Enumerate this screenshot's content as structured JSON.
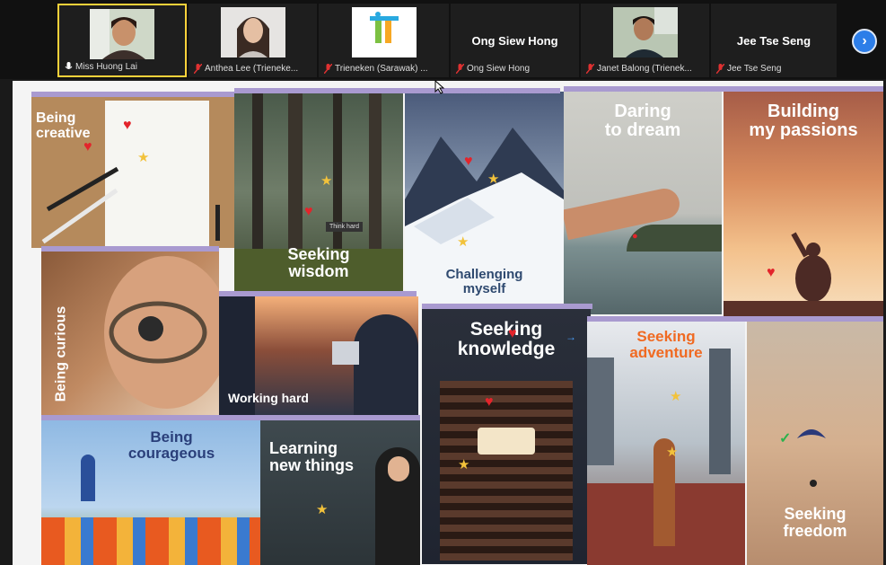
{
  "participants": [
    {
      "name": "Miss Huong Lai",
      "video": "person"
    },
    {
      "name": "Anthea Lee (Trieneke...",
      "video": "person"
    },
    {
      "name": "Trieneken (Sarawak) ...",
      "video": "logo"
    },
    {
      "name": "Ong Siew Hong",
      "big_name": "Ong Siew Hong",
      "video": "none"
    },
    {
      "name": "Janet Balong (Trienek...",
      "video": "person"
    },
    {
      "name": "Jee Tse Seng",
      "big_name": "Jee Tse Seng",
      "video": "none"
    }
  ],
  "next_icon": "chevron-right-icon",
  "board": {
    "cards": [
      {
        "label": "Being\ncreative"
      },
      {
        "label": "Seeking\nwisdom"
      },
      {
        "label": "Challenging\nmyself"
      },
      {
        "label": "Daring\nto dream"
      },
      {
        "label": "Building\nmy passions"
      },
      {
        "label": "Being curious"
      },
      {
        "label": "Working hard"
      },
      {
        "label": "Seeking\nknowledge"
      },
      {
        "label": "Seeking\nadventure"
      },
      {
        "label": "Being\ncourageous"
      },
      {
        "label": "Learning\nnew things"
      },
      {
        "label": "Seeking\nfreedom"
      }
    ],
    "sticker": "Think hard"
  },
  "colors": {
    "active_speaker": "#ffd23a",
    "accent_bar": "#a99ad0",
    "next_button": "#2d7ee8"
  }
}
